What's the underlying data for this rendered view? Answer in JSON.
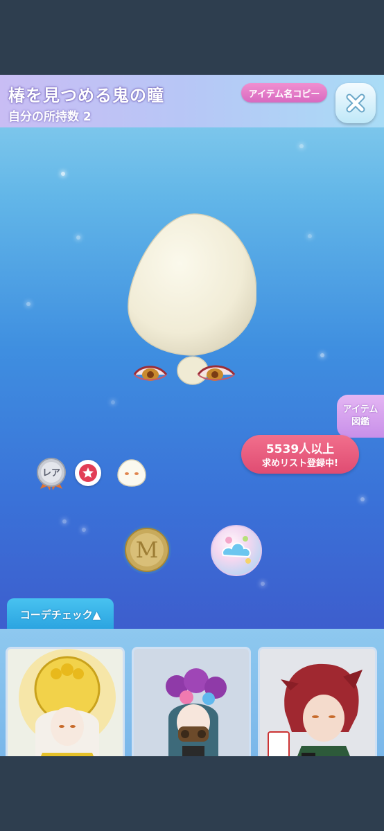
{
  "item": {
    "title": "椿を見つめる鬼の瞳",
    "owned_text": "自分の所持数 2"
  },
  "header": {
    "copy_label": "アイテム名コピー",
    "close_icon": "close-x-icon"
  },
  "encyclopedia": {
    "line1": "アイテム",
    "line2": "図鑑"
  },
  "badges": {
    "rarity_label": "レア",
    "star_icon": "star-icon",
    "part_icon": "face-part-icon"
  },
  "wishlist": {
    "count_text": "5539人以上",
    "label": "求めリスト登録中!"
  },
  "currencies": {
    "coin_icon": "m-coin-icon",
    "special_icon": "cloud-coin-icon"
  },
  "coordinate": {
    "tab_label": "コーデチェック▲",
    "cards": [
      {
        "name": "gold-crown-avatar"
      },
      {
        "name": "flower-mask-avatar"
      },
      {
        "name": "red-hair-avatar"
      }
    ]
  },
  "colors": {
    "header_gradient_start": "#c9bdf4",
    "header_gradient_end": "#a9dcf6",
    "wish_pill": "#e04c72",
    "tab_blue": "#2aa3e0"
  }
}
